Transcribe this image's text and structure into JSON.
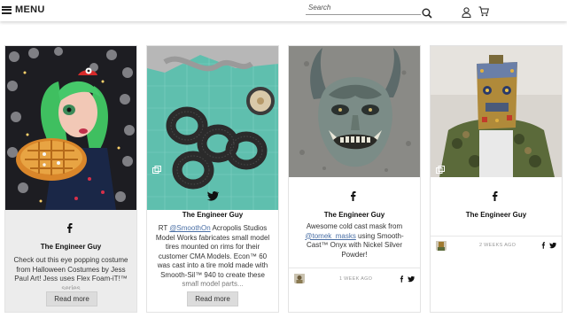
{
  "header": {
    "menu_label": "MENU",
    "search_placeholder": "Search",
    "icons": [
      "hamburger-icon",
      "search-icon",
      "user-icon",
      "cart-icon"
    ]
  },
  "cards": [
    {
      "network": "facebook",
      "author": "The Engineer Guy",
      "text": "Check out this eye popping costume from Halloween Costumes by Jess Paul Art! Jess uses Flex Foam-iT!™ series",
      "button": "Read more"
    },
    {
      "network": "twitter",
      "author": "The Engineer Guy",
      "text_prefix": "RT ",
      "mention": "@SmoothOn",
      "text_rest": " Acropolis Studios Model Works fabricates small model tires mounted on rims for their customer CMA Models. Econ™ 60 was cast into a tire mold made with Smooth-Sil™ 940 to create these small model parts...",
      "button": "Read more"
    },
    {
      "network": "facebook",
      "author": "The Engineer Guy",
      "text_prefix": "Awesome cold cast mask from ",
      "mention": "@tomek_masks",
      "text_rest": " using Smooth-Cast™ Onyx with Nickel Silver Powder!",
      "date": "1 WEEK AGO"
    },
    {
      "network": "facebook",
      "author": "The Engineer Guy",
      "date": "2 WEEKS AGO"
    }
  ],
  "colors": {
    "mention": "#4a6fa5",
    "button_bg": "#dcdcdc"
  }
}
